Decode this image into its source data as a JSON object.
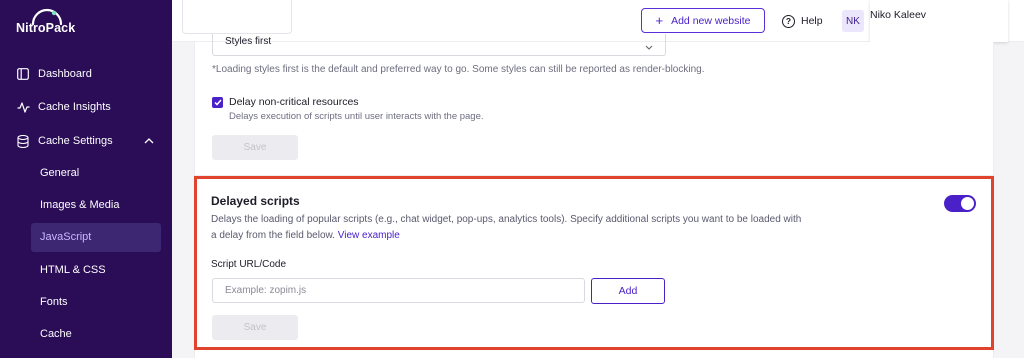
{
  "brand": {
    "name": "NitroPack"
  },
  "sidebar": {
    "items": [
      {
        "label": "Dashboard",
        "icon": "dashboard-icon"
      },
      {
        "label": "Cache Insights",
        "icon": "pulse-icon"
      },
      {
        "label": "Cache Settings",
        "icon": "database-icon",
        "expanded": true
      }
    ],
    "sub_items": [
      {
        "label": "General"
      },
      {
        "label": "Images & Media"
      },
      {
        "label": "JavaScript",
        "active": true
      },
      {
        "label": "HTML & CSS"
      },
      {
        "label": "Fonts"
      },
      {
        "label": "Cache"
      }
    ]
  },
  "header": {
    "add_site_label": "Add new website",
    "help_label": "Help",
    "avatar_initials": "NK",
    "user_name": "Niko Kaleev"
  },
  "styles_section": {
    "select_value": "Styles first",
    "note": "*Loading styles first is the default and preferred way to go. Some styles can still be reported as render-blocking.",
    "delay_checkbox_label": "Delay non-critical resources",
    "delay_checkbox_checked": true,
    "delay_checkbox_desc": "Delays execution of scripts until user interacts with the page.",
    "save_label": "Save"
  },
  "delayed_scripts": {
    "title": "Delayed scripts",
    "desc_line1": "Delays the loading of popular scripts (e.g., chat widget, pop-ups, analytics tools). Specify additional scripts you want to be loaded with",
    "desc_line2": "a delay from the field below.",
    "link_label": "View example",
    "enabled": true,
    "field_label": "Script URL/Code",
    "field_placeholder": "Example: zopim.js",
    "add_label": "Add",
    "save_label": "Save"
  },
  "colors": {
    "sidebar_bg": "#2a0c57",
    "accent": "#4a21c9",
    "highlight_border": "#e0442f"
  }
}
